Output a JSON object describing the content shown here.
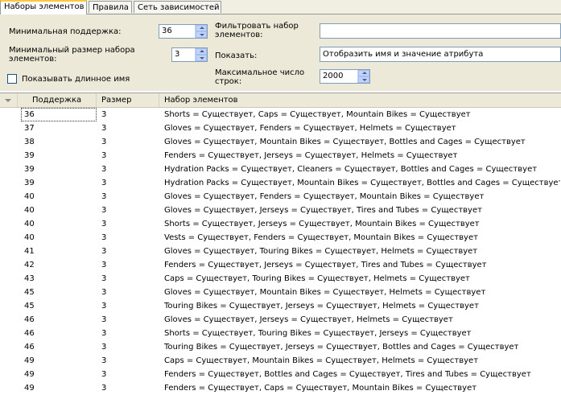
{
  "tabs": [
    "Наборы элементов",
    "Правила",
    "Сеть зависимостей"
  ],
  "settings": {
    "min_support_label": "Минимальная поддержка:",
    "min_support_value": "36",
    "min_itemset_size_label": "Минимальный размер набора элементов:",
    "min_itemset_size_value": "3",
    "show_long_name_label": "Показывать длинное имя",
    "filter_label": "Фильтровать набор элементов:",
    "filter_value": "",
    "show_label": "Показать:",
    "show_value": "Отобразить имя и значение атрибута",
    "max_rows_label": "Максимальное число строк:",
    "max_rows_value": "2000"
  },
  "grid": {
    "columns": [
      "Поддержка",
      "Размер",
      "Набор элементов"
    ],
    "rows": [
      {
        "support": "36",
        "size": "3",
        "itemset": "Shorts = Существует, Caps = Существует, Mountain Bikes = Существует"
      },
      {
        "support": "37",
        "size": "3",
        "itemset": "Gloves = Существует, Fenders = Существует, Helmets = Существует"
      },
      {
        "support": "38",
        "size": "3",
        "itemset": "Gloves = Существует, Mountain Bikes = Существует, Bottles and Cages = Существует"
      },
      {
        "support": "39",
        "size": "3",
        "itemset": "Fenders = Существует, Jerseys = Существует, Helmets = Существует"
      },
      {
        "support": "39",
        "size": "3",
        "itemset": "Hydration Packs = Существует, Cleaners = Существует, Bottles and Cages = Существует"
      },
      {
        "support": "39",
        "size": "3",
        "itemset": "Hydration Packs = Существует, Mountain Bikes = Существует, Bottles and Cages = Существует"
      },
      {
        "support": "40",
        "size": "3",
        "itemset": "Gloves = Существует, Fenders = Существует, Mountain Bikes = Существует"
      },
      {
        "support": "40",
        "size": "3",
        "itemset": "Gloves = Существует, Jerseys = Существует, Tires and Tubes = Существует"
      },
      {
        "support": "40",
        "size": "3",
        "itemset": "Shorts = Существует, Jerseys = Существует, Mountain Bikes = Существует"
      },
      {
        "support": "40",
        "size": "3",
        "itemset": "Vests = Существует, Fenders = Существует, Mountain Bikes = Существует"
      },
      {
        "support": "41",
        "size": "3",
        "itemset": "Gloves = Существует, Touring Bikes = Существует, Helmets = Существует"
      },
      {
        "support": "42",
        "size": "3",
        "itemset": "Fenders = Существует, Jerseys = Существует, Tires and Tubes = Существует"
      },
      {
        "support": "43",
        "size": "3",
        "itemset": "Caps = Существует, Touring Bikes = Существует, Helmets = Существует"
      },
      {
        "support": "45",
        "size": "3",
        "itemset": "Gloves = Существует, Mountain Bikes = Существует, Helmets = Существует"
      },
      {
        "support": "45",
        "size": "3",
        "itemset": "Touring Bikes = Существует, Jerseys = Существует, Helmets = Существует"
      },
      {
        "support": "46",
        "size": "3",
        "itemset": "Gloves = Существует, Jerseys = Существует, Helmets = Существует"
      },
      {
        "support": "46",
        "size": "3",
        "itemset": "Shorts = Существует, Touring Bikes = Существует, Jerseys = Существует"
      },
      {
        "support": "46",
        "size": "3",
        "itemset": "Touring Bikes = Существует, Jerseys = Существует, Bottles and Cages = Существует"
      },
      {
        "support": "49",
        "size": "3",
        "itemset": "Caps = Существует, Mountain Bikes = Существует, Helmets = Существует"
      },
      {
        "support": "49",
        "size": "3",
        "itemset": "Fenders = Существует, Bottles and Cages = Существует, Tires and Tubes = Существует"
      },
      {
        "support": "49",
        "size": "3",
        "itemset": "Fenders = Существует, Caps = Существует, Mountain Bikes = Существует"
      }
    ]
  }
}
